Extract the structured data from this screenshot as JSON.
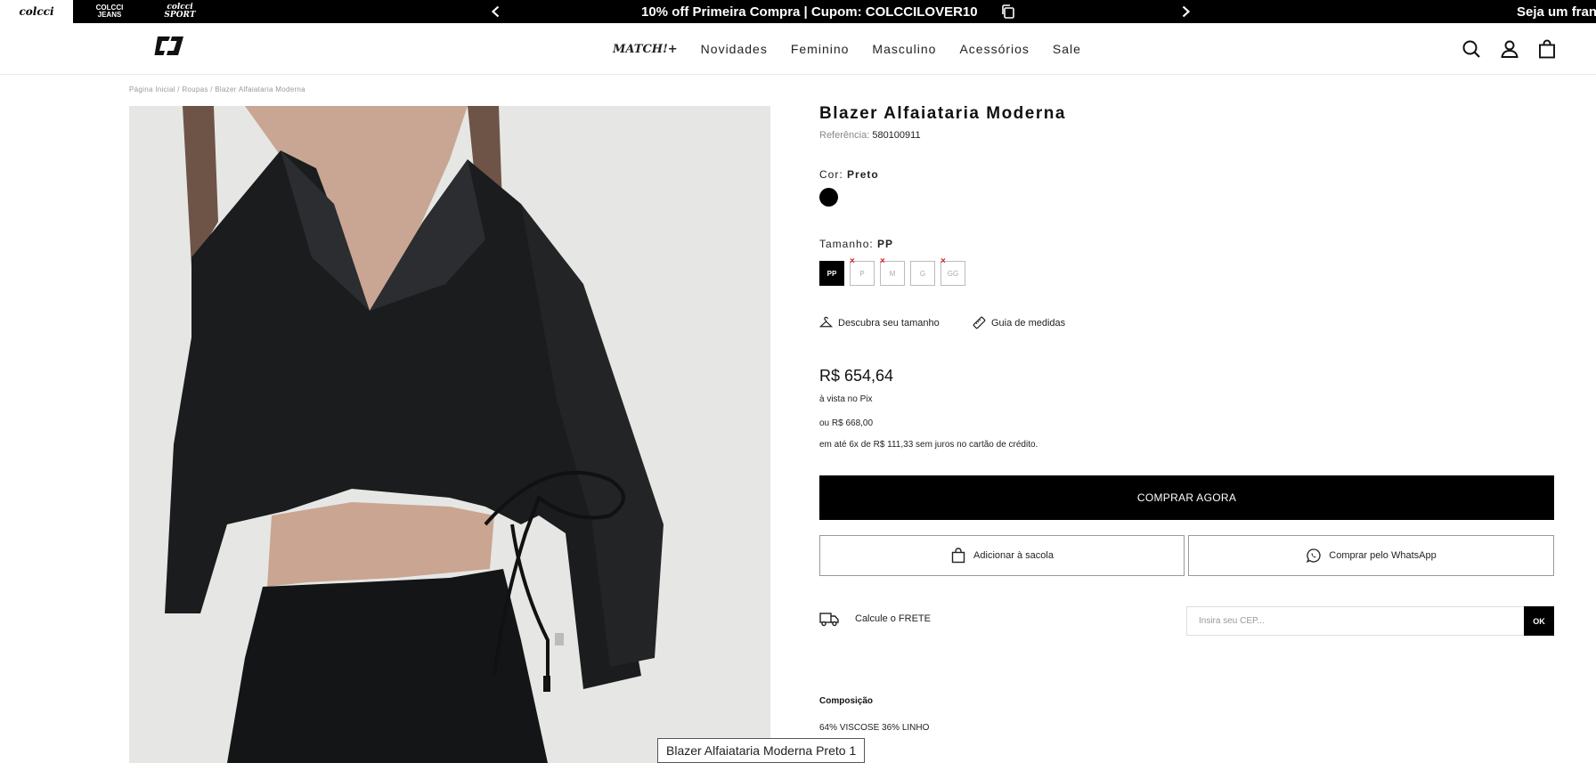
{
  "topbar": {
    "brands": [
      "colcci",
      "COLCCI\nJEANS",
      "colcci\nSPORT"
    ],
    "promo": "10% off Primeira Compra | Cupom: COLCCILOVER10",
    "promo_next": "Seja um franq"
  },
  "header": {
    "nav": [
      "MATCH!+",
      "Novidades",
      "Feminino",
      "Masculino",
      "Acessórios",
      "Sale"
    ]
  },
  "breadcrumb": "Página Inicial / Roupas / Blazer Alfaiataria Moderna",
  "product": {
    "title": "Blazer Alfaiataria Moderna",
    "ref_label": "Referência:",
    "ref_value": "580100911",
    "color_label": "Cor:",
    "color_value": "Preto",
    "color_swatch": "#000000",
    "size_label": "Tamanho:",
    "size_value": "PP",
    "sizes": [
      {
        "label": "PP",
        "selected": true,
        "unavailable": false
      },
      {
        "label": "P",
        "selected": false,
        "unavailable": true
      },
      {
        "label": "M",
        "selected": false,
        "unavailable": true
      },
      {
        "label": "G",
        "selected": false,
        "unavailable": false
      },
      {
        "label": "GG",
        "selected": false,
        "unavailable": true
      }
    ],
    "size_finder": "Descubra seu tamanho",
    "size_guide": "Guia de medidas",
    "price": "R$ 654,64",
    "price_pix": "à vista no Pix",
    "price_full": "ou R$ 668,00",
    "installments": "em até 6x de R$ 111,33 sem juros no cartão de crédito.",
    "buy_now": "COMPRAR AGORA",
    "add_to_bag": "Adicionar à sacola",
    "whatsapp": "Comprar pelo WhatsApp",
    "freight_label": "Calcule o FRETE",
    "cep_placeholder": "Insira seu CEP...",
    "cep_ok": "OK",
    "composition_title": "Composição",
    "composition_value": "64% VISCOSE 36% LINHO",
    "image_tooltip": "Blazer Alfaiataria Moderna Preto 1"
  }
}
